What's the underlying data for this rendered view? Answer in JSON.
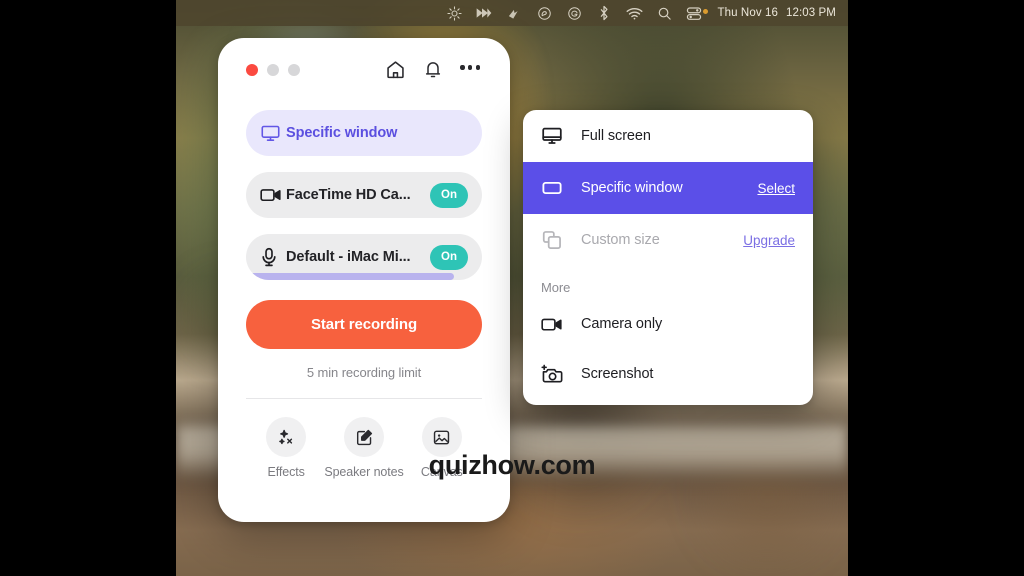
{
  "menubar": {
    "icons": [
      "sun-brightness-icon",
      "fast-forward-icon",
      "wifi-signal-icon",
      "creative-cloud-icon",
      "grammarly-icon",
      "bluetooth-icon",
      "wifi-icon",
      "search-icon",
      "control-center-icon"
    ],
    "day": "Thu Nov 16",
    "time": "12:03 PM"
  },
  "panel": {
    "traffic_lights": [
      "close-button",
      "minimize-button",
      "maximize-button"
    ],
    "header_icons": [
      "home-icon",
      "bell-icon",
      "more-options-icon"
    ],
    "source_row": {
      "icon": "monitor-icon",
      "label": "Specific window"
    },
    "camera_row": {
      "icon": "video-camera-icon",
      "label": "FaceTime HD Ca...",
      "toggle": "On"
    },
    "mic_row": {
      "icon": "microphone-icon",
      "label": "Default - iMac Mi...",
      "toggle": "On"
    },
    "record_button": "Start recording",
    "limit_note": "5 min recording limit",
    "tools": [
      {
        "icon": "sparkles-icon",
        "label": "Effects"
      },
      {
        "icon": "edit-square-icon",
        "label": "Speaker notes"
      },
      {
        "icon": "image-icon",
        "label": "Canvas"
      }
    ]
  },
  "menu": {
    "items": [
      {
        "icon": "desktop-monitor-icon",
        "label": "Full screen",
        "action": "",
        "state": "normal"
      },
      {
        "icon": "window-rect-icon",
        "label": "Specific window",
        "action": "Select",
        "state": "active"
      },
      {
        "icon": "custom-size-icon",
        "label": "Custom size",
        "action": "Upgrade",
        "state": "disabled"
      }
    ],
    "more_header": "More",
    "more_items": [
      {
        "icon": "video-camera-icon",
        "label": "Camera only"
      },
      {
        "icon": "screenshot-camera-icon",
        "label": "Screenshot"
      }
    ]
  },
  "watermark": "quizhow.com",
  "colors": {
    "accent_purple": "#5b4fe8",
    "record_orange": "#f7613e",
    "toggle_teal": "#2ec4b6",
    "selected_lavender": "#e9e7fc"
  }
}
